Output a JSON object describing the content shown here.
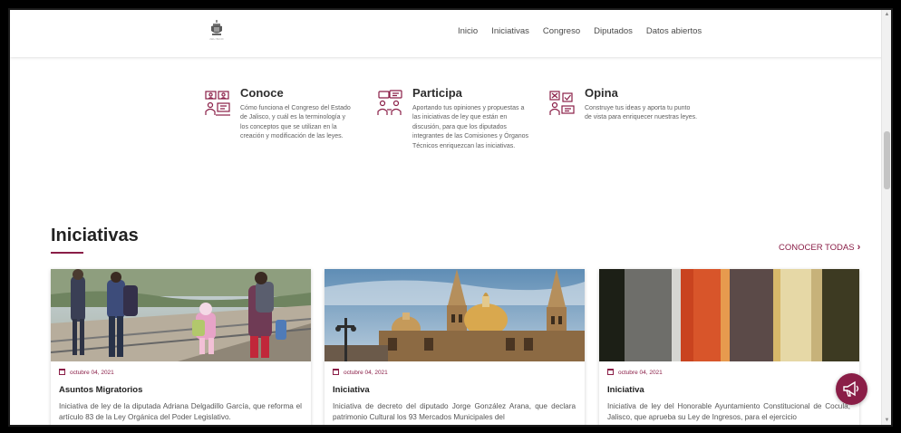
{
  "nav": {
    "logo_text": "JALISCO",
    "links": [
      "Inicio",
      "Iniciativas",
      "Congreso",
      "Diputados",
      "Datos abiertos"
    ]
  },
  "features": [
    {
      "title": "Conoce",
      "text": "Cómo funciona el Congreso del Estado de Jalisco, y cuál es la terminología y los conceptos que se utilizan en la creación y modificación de las leyes."
    },
    {
      "title": "Participa",
      "text": "Aportando tus opiniones y propuestas a las iniciativas de ley que están en discusión, para que los diputados integrantes de las Comisiones y Órganos Técnicos enriquezcan las iniciativas."
    },
    {
      "title": "Opina",
      "text": "Construye tus ideas y aporta tu punto de vista para enriquecer nuestras leyes."
    }
  ],
  "section": {
    "title": "Iniciativas",
    "see_all": "CONOCER TODAS",
    "see_all_chevron": "›"
  },
  "cards": [
    {
      "date": "octubre 04, 2021",
      "title": "Asuntos Migratorios",
      "text": "Iniciativa de ley de la diputada Adriana Delgadillo García, que reforma el artículo 83 de la Ley Orgánica del Poder Legislativo."
    },
    {
      "date": "octubre 04, 2021",
      "title": "Iniciativa",
      "text": "Iniciativa de decreto del diputado Jorge González Arana, que declara patrimonio Cultural los 93 Mercados Municipales del"
    },
    {
      "date": "octubre 04, 2021",
      "title": "Iniciativa",
      "text": "Iniciativa de ley del Honorable Ayuntamiento Constitucional de Cocula, Jalisco, que aprueba su Ley de Ingresos, para el ejercicio"
    }
  ],
  "scrollbar": {
    "up": "▲",
    "down": "▼"
  },
  "colors": {
    "accent": "#8a1e47",
    "text": "#333333",
    "background": "#ffffff"
  }
}
